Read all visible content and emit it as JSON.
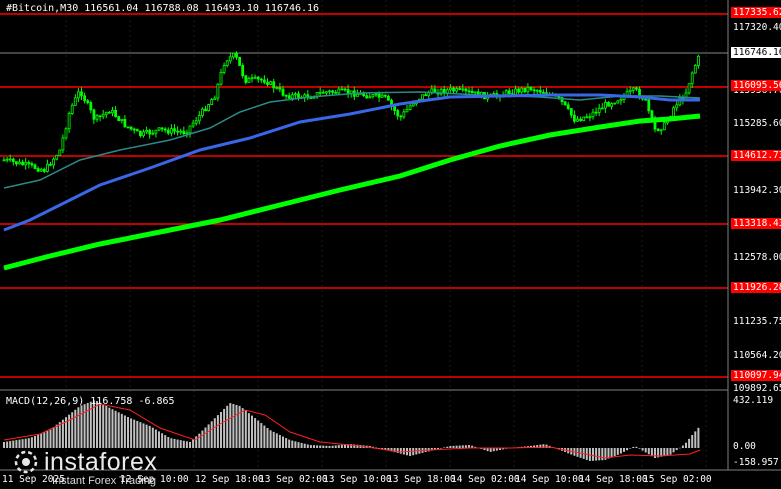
{
  "header": {
    "title": "#Bitcoin,M30  116561.04 116788.08 116493.10 116746.16"
  },
  "macd": {
    "title": "MACD(12,26,9) 116.758 -6.865",
    "axis": [
      "432.119",
      "0.00",
      "-158.957"
    ]
  },
  "price_axis": {
    "labels": [
      "117320.40",
      "115956.70",
      "115285.60",
      "113942.30",
      "112578.00",
      "111235.75",
      "110564.20",
      "109892.65"
    ]
  },
  "levels": [
    {
      "label": "117335.62",
      "color": "#ff0000"
    },
    {
      "label": "116095.56",
      "color": "#ff0000"
    },
    {
      "label": "114612.73",
      "color": "#ff0000"
    },
    {
      "label": "113318.43",
      "color": "#ff0000"
    },
    {
      "label": "111926.28",
      "color": "#ff0000"
    },
    {
      "label": "110097.94",
      "color": "#ff0000"
    }
  ],
  "current_price": {
    "label": "116746.16"
  },
  "time_axis": [
    "11 Sep 2025",
    "12 Sep 10:00",
    "12 Sep 18:00",
    "13 Sep 02:00",
    "13 Sep 10:00",
    "13 Sep 18:00",
    "14 Sep 02:00",
    "14 Sep 10:00",
    "14 Sep 18:00",
    "15 Sep 02:00"
  ],
  "logo": {
    "name": "instaforex",
    "tagline": "Instant Forex Trading"
  },
  "colors": {
    "background": "#000000",
    "candle": "#00ff00",
    "level": "#ff0000",
    "ma_fast": "#2a8a8a",
    "ma_mid": "#3a66e8",
    "ma_slow": "#00ff00",
    "macd_hist": "#c0c0c0",
    "macd_signal": "#ff2020"
  }
}
